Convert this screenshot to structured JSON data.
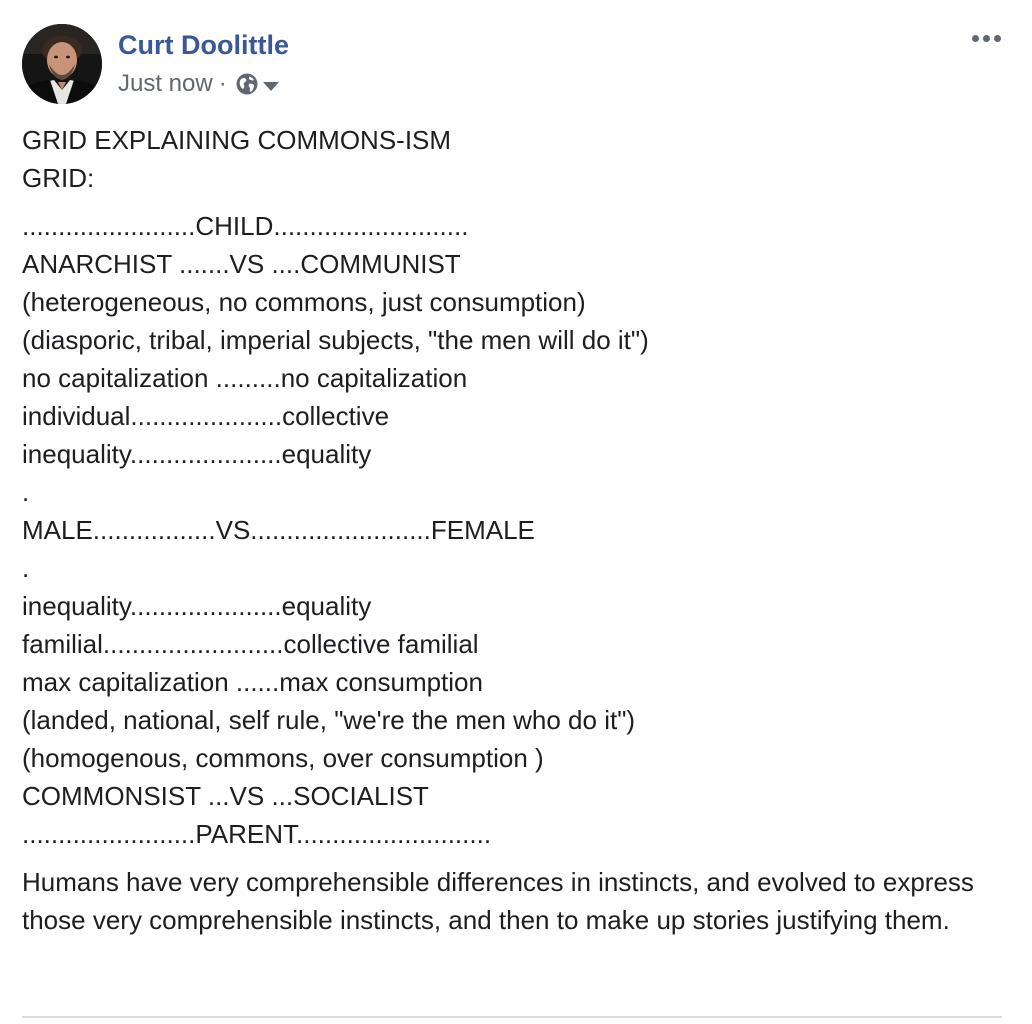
{
  "post": {
    "author": "Curt Doolittle",
    "timestamp": "Just now",
    "separator": "·",
    "audience_icon": "globe-icon",
    "audience_dropdown_icon": "caret-down-icon",
    "more_icon": "more-options-icon",
    "title_lines": [
      "GRID EXPLAINING COMMONS-ISM",
      "GRID:"
    ],
    "grid_lines": [
      "........................CHILD...........................",
      "ANARCHIST .......VS ....COMMUNIST",
      "(heterogeneous, no commons, just consumption)",
      "(diasporic, tribal, imperial subjects, \"the men will do it\")",
      "no capitalization .........no capitalization",
      "individual.....................collective",
      "inequality.....................equality",
      ".",
      "MALE.................VS.........................FEMALE",
      ".",
      "inequality.....................equality",
      "familial.........................collective familial",
      "max capitalization ......max consumption",
      "(landed, national, self rule, \"we're the men who do it\")",
      "(homogenous, commons, over consumption )",
      "COMMONSIST ...VS ...SOCIALIST",
      "........................PARENT..........................."
    ],
    "closing_text": "Humans have very comprehensible differences in instincts, and evolved to express those very comprehensible instincts, and then to make up stories justifying them."
  },
  "colors": {
    "author_link": "#385898",
    "meta_text": "#616770",
    "body_text": "#1c1e21",
    "divider": "#dadde1"
  }
}
